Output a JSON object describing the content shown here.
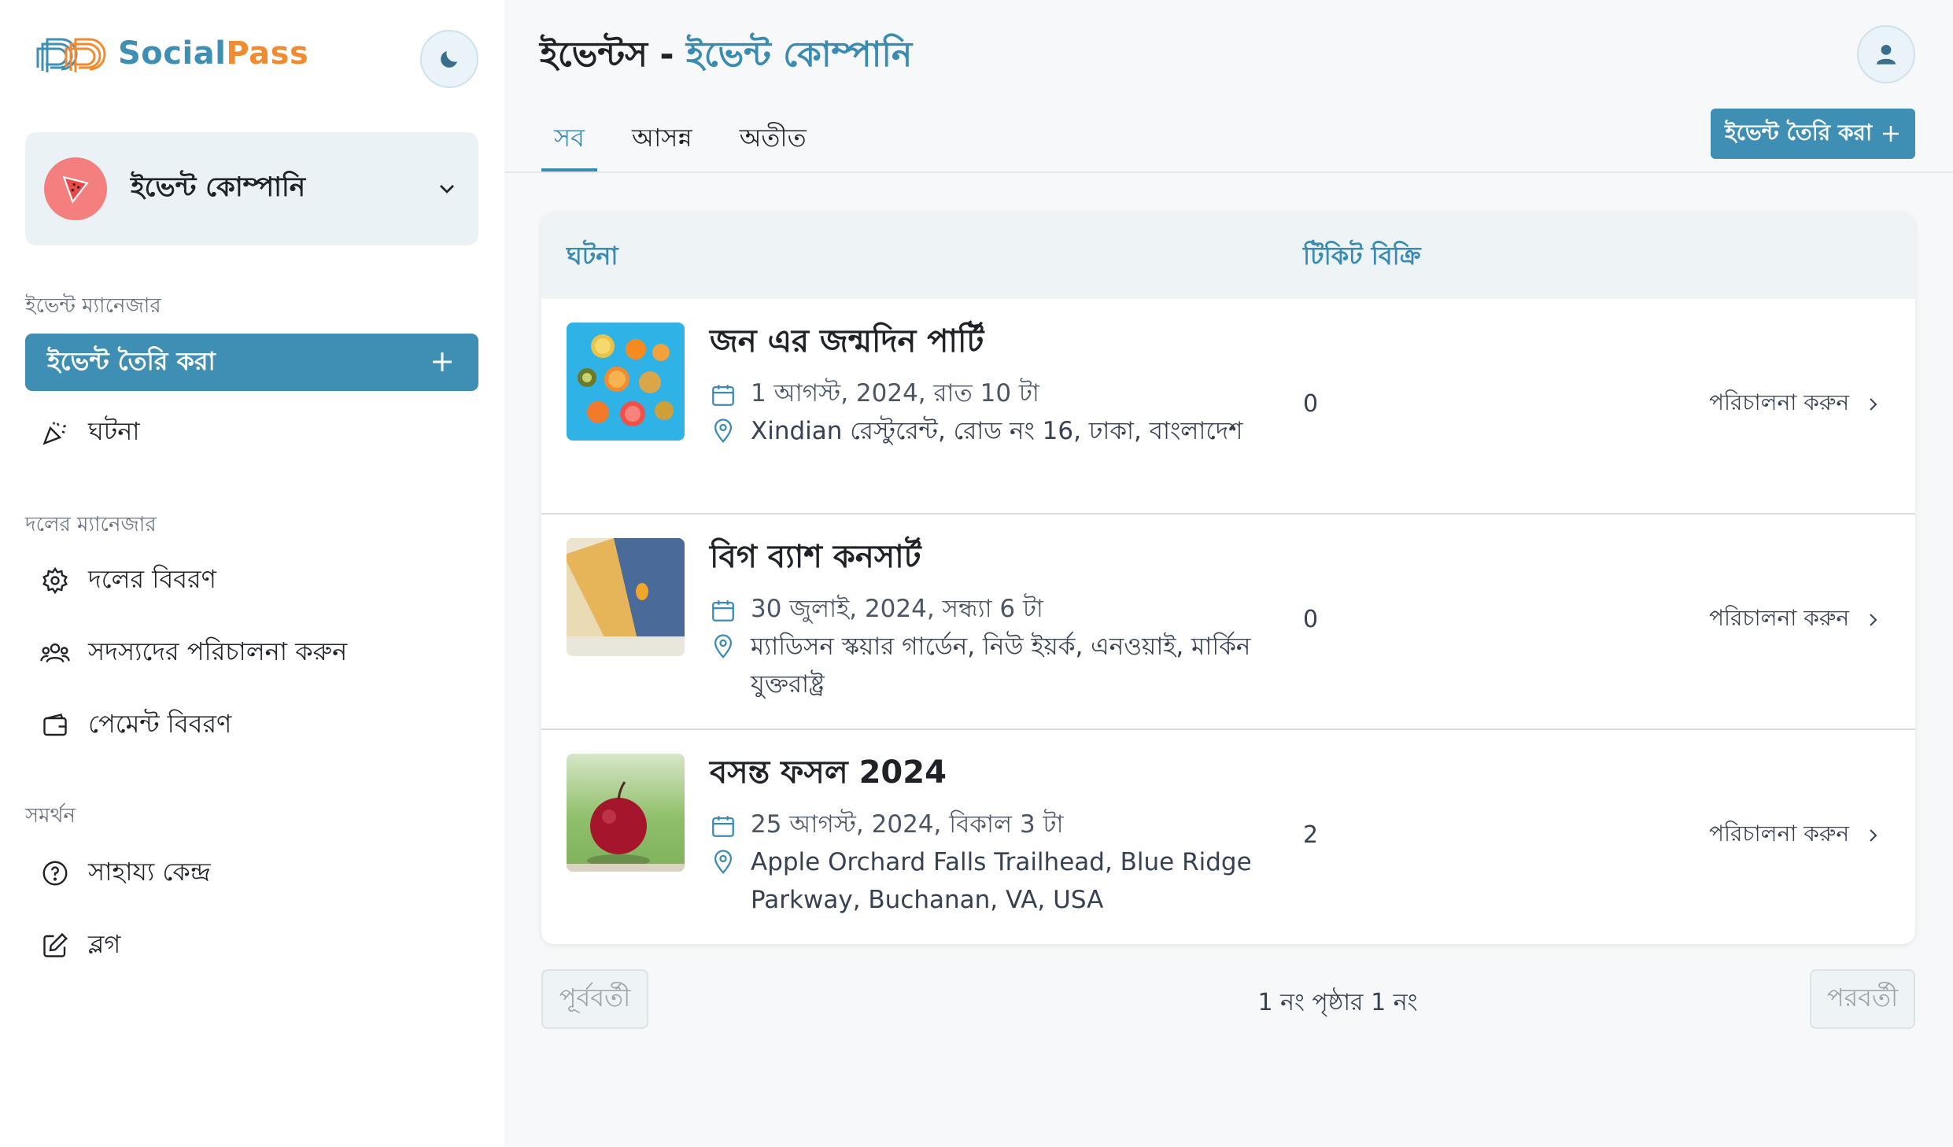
{
  "brand": {
    "name_part1": "Social",
    "name_part2": "Pass"
  },
  "team": {
    "name": "ইভেন্ট কোম্পানি"
  },
  "sidebar": {
    "event_manager_label": "ইভেন্ট ম্যানেজার",
    "create_event_label": "ইভেন্ট তৈরি করা",
    "events_label": "ঘটনা",
    "team_manager_label": "দলের ম্যানেজার",
    "team_details_label": "দলের বিবরণ",
    "manage_members_label": "সদস্যদের পরিচালনা করুন",
    "payment_details_label": "পেমেন্ট বিবরণ",
    "support_label": "সমর্থন",
    "help_center_label": "সাহায্য কেন্দ্র",
    "blog_label": "ব্লগ"
  },
  "header": {
    "title_prefix": "ইভেন্টস - ",
    "title_accent": "ইভেন্ট কোম্পানি",
    "create_button_label": "ইভেন্ট তৈরি করা"
  },
  "tabs": [
    {
      "label": "সব",
      "active": true
    },
    {
      "label": "আসন্ন",
      "active": false
    },
    {
      "label": "অতীত",
      "active": false
    }
  ],
  "table": {
    "col_event": "ঘটনা",
    "col_tickets_sold": "টিকিট বিক্রি",
    "manage_label": "পরিচালনা করুন",
    "rows": [
      {
        "title": "জন এর জন্মদিন পার্টি",
        "date": "1 আগস্ট, 2024, রাত 10 টা",
        "location": "Xindian রেস্টুরেন্ট, রোড নং 16, ঢাকা, বাংলাদেশ",
        "tickets_sold": "0"
      },
      {
        "title": "বিগ ব্যাশ কনসার্ট",
        "date": "30 জুলাই, 2024, সন্ধ্যা 6 টা",
        "location": "ম্যাডিসন স্কয়ার গার্ডেন, নিউ ইয়র্ক, এনওয়াই, মার্কিন যুক্তরাষ্ট্র",
        "tickets_sold": "0"
      },
      {
        "title": "বসন্ত ফসল 2024",
        "date": "25 আগস্ট, 2024, বিকাল 3 টা",
        "location": "Apple Orchard Falls Trailhead, Blue Ridge Parkway, Buchanan, VA, USA",
        "tickets_sold": "2"
      }
    ]
  },
  "pagination": {
    "previous_label": "পূর্ববর্তী",
    "next_label": "পরবর্তী",
    "page_text": "1 নং পৃষ্ঠার 1 নং"
  },
  "colors": {
    "accent": "#3f8fb4",
    "brand_orange": "#f28b2f",
    "brand_blue": "#3d8fb6"
  }
}
